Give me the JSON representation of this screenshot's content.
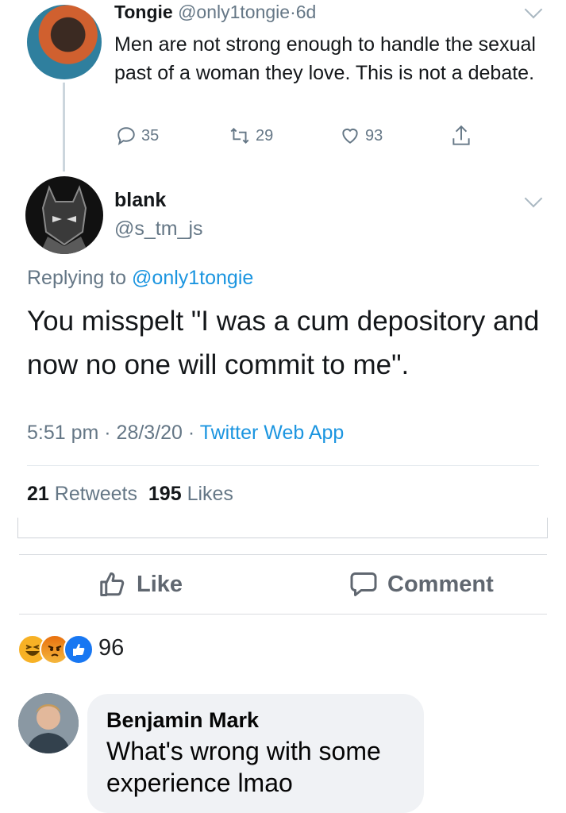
{
  "quoted_tweet": {
    "display_name": "Tongie",
    "handle": "@only1tongie",
    "separator": "·",
    "age": "6d",
    "text": "Men are not strong enough to handle the sexual past of a woman they love. This is not a debate.",
    "replies": "35",
    "retweets": "29",
    "likes": "93"
  },
  "main_tweet": {
    "display_name": "blank",
    "handle": "@s_tm_js",
    "replying_prefix": "Replying to",
    "replying_to": "@only1tongie",
    "text": "You misspelt \"I was a cum depository and now no one will commit to me\".",
    "time": "5:51 pm · 28/3/20",
    "source_sep": " · ",
    "source": "Twitter Web App",
    "retweet_count": "21",
    "retweet_label": "Retweets",
    "like_count": "195",
    "like_label": "Likes"
  },
  "facebook": {
    "like_label": "Like",
    "comment_label": "Comment",
    "reaction_count": "96",
    "comment": {
      "author": "Benjamin Mark",
      "text": "What's wrong with some experience lmao"
    }
  }
}
